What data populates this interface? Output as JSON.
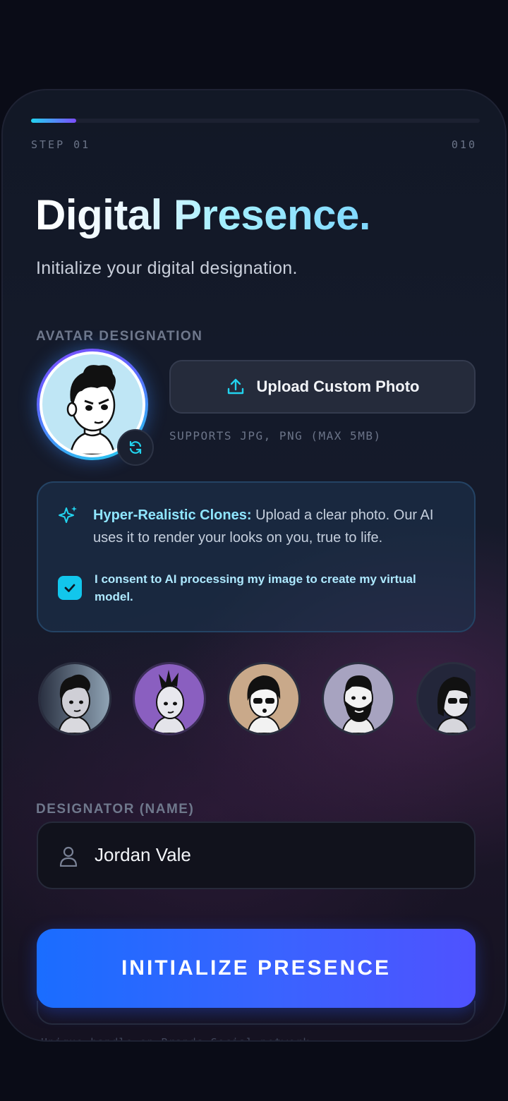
{
  "progress": {
    "step_label": "STEP 01",
    "total_label": "010",
    "fraction": 0.1
  },
  "header": {
    "title": "Digital Presence.",
    "subtitle": "Initialize your digital designation."
  },
  "avatar_section": {
    "label": "AVATAR DESIGNATION",
    "refresh_icon": "refresh-icon",
    "upload_button": "Upload Custom Photo",
    "upload_icon": "upload-icon",
    "upload_hint": "SUPPORTS JPG, PNG (MAX 5MB)"
  },
  "info": {
    "icon": "sparkle-icon",
    "headline": "Hyper-Realistic Clones:",
    "body": " Upload a clear photo. Our AI uses it to render your looks on you, true to life.",
    "consent_checked": true,
    "consent_text": "I consent to AI processing my image to create my virtual model."
  },
  "preset_avatars": [
    {
      "name": "Avatar 1",
      "bg": "#8fa3b4"
    },
    {
      "name": "Avatar 2",
      "bg": "#8a5fc0"
    },
    {
      "name": "Avatar 3",
      "bg": "#c9a98a"
    },
    {
      "name": "Avatar 4",
      "bg": "#a7a3c0"
    },
    {
      "name": "Avatar 5",
      "bg": "#23263a"
    }
  ],
  "name_section": {
    "label": "DESIGNATOR (NAME)",
    "value": "Jordan Vale",
    "icon": "user-icon"
  },
  "cta": {
    "label": "INITIALIZE PRESENCE"
  },
  "footer_hint": "Unique handle on Brands Social network"
}
